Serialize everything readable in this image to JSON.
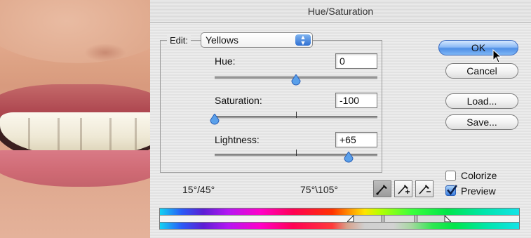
{
  "dialog": {
    "title": "Hue/Saturation",
    "edit_label": "Edit:",
    "edit_value": "Yellows",
    "fields": {
      "hue": {
        "label": "Hue:",
        "value": "0",
        "fraction": 0.5
      },
      "saturation": {
        "label": "Saturation:",
        "value": "-100",
        "fraction": 0.0
      },
      "lightness": {
        "label": "Lightness:",
        "value": "+65",
        "fraction": 0.825
      }
    },
    "buttons": {
      "ok": "OK",
      "cancel": "Cancel",
      "load": "Load...",
      "save": "Save..."
    },
    "options": {
      "colorize": {
        "label": "Colorize",
        "checked": false
      },
      "preview": {
        "label": "Preview",
        "checked": true
      }
    },
    "range": {
      "left": "15°/45°",
      "right": "75°\\105°"
    },
    "eyedroppers": [
      "eyedropper-icon",
      "eyedropper-plus-icon",
      "eyedropper-minus-icon"
    ]
  },
  "colors": {
    "accent": "#3a7ee0",
    "thumb": "#5aa0ea"
  }
}
